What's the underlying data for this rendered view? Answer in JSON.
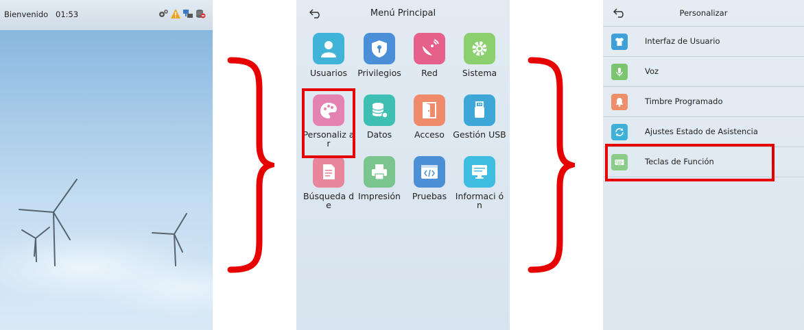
{
  "home": {
    "welcome": "Bienvenido",
    "time": "01:53",
    "status_icons": [
      "gears-icon",
      "warning-icon",
      "network-icon",
      "database-icon"
    ]
  },
  "menu": {
    "title": "Menú Principal",
    "tiles": [
      {
        "label": "Usuarios",
        "icon": "user-icon",
        "color": "#3fb4d8"
      },
      {
        "label": "Privilegios",
        "icon": "shield-icon",
        "color": "#4a8fd8"
      },
      {
        "label": "Red",
        "icon": "satellite-dish-icon",
        "color": "#e5608a"
      },
      {
        "label": "Sistema",
        "icon": "gear-icon",
        "color": "#8ccf6e"
      },
      {
        "label": "Personaliz ar",
        "icon": "palette-icon",
        "color": "#e483b2"
      },
      {
        "label": "Datos",
        "icon": "database-icon",
        "color": "#3fbfb3"
      },
      {
        "label": "Acceso",
        "icon": "door-icon",
        "color": "#ef8a6a"
      },
      {
        "label": "Gestión USB",
        "icon": "usb-icon",
        "color": "#3fa7d8"
      },
      {
        "label": "Búsqueda de",
        "icon": "document-search-icon",
        "color": "#e8869b"
      },
      {
        "label": "Impresión",
        "icon": "printer-icon",
        "color": "#7ac58d"
      },
      {
        "label": "Pruebas",
        "icon": "code-window-icon",
        "color": "#4b8fd6"
      },
      {
        "label": "Informaci ón",
        "icon": "monitor-icon",
        "color": "#3fbde0"
      }
    ]
  },
  "custom": {
    "title": "Personalizar",
    "items": [
      {
        "label": "Interfaz de Usuario",
        "icon": "shirt-icon",
        "color": "#3fa0d8"
      },
      {
        "label": "Voz",
        "icon": "microphone-icon",
        "color": "#7cc46f"
      },
      {
        "label": "Timbre Programado",
        "icon": "bell-icon",
        "color": "#ef8e6a"
      },
      {
        "label": "Ajustes Estado de Asistencia",
        "icon": "refresh-icon",
        "color": "#3fb0d8"
      },
      {
        "label": "Teclas de Función",
        "icon": "keyboard-icon",
        "color": "#8ccc8a"
      }
    ]
  },
  "colors": {
    "highlight": "#e60000",
    "brace": "#e60000"
  }
}
